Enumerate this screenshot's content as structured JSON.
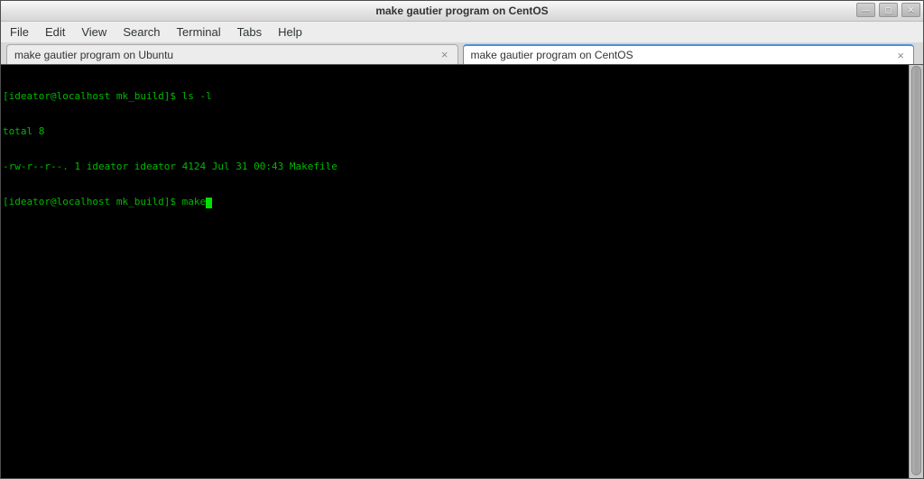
{
  "window": {
    "title": "make gautier program on CentOS",
    "controls": {
      "minimize": "—",
      "maximize": "▢",
      "close": "✕"
    }
  },
  "menu": {
    "items": [
      {
        "label": "File"
      },
      {
        "label": "Edit"
      },
      {
        "label": "View"
      },
      {
        "label": "Search"
      },
      {
        "label": "Terminal"
      },
      {
        "label": "Tabs"
      },
      {
        "label": "Help"
      }
    ]
  },
  "tabs": [
    {
      "label": "make gautier program on Ubuntu",
      "active": false,
      "close_glyph": "×"
    },
    {
      "label": "make gautier program on CentOS",
      "active": true,
      "close_glyph": "×"
    }
  ],
  "terminal": {
    "lines": [
      "[ideator@localhost mk_build]$ ls -l",
      "total 8",
      "-rw-r--r--. 1 ideator ideator 4124 Jul 31 00:43 Makefile",
      "[ideator@localhost mk_build]$ make"
    ],
    "cursor_visible": true
  },
  "colors": {
    "terminal_background": "#000000",
    "terminal_text": "#00b800",
    "cursor": "#00e000",
    "active_tab_accent": "#4a90d9"
  }
}
